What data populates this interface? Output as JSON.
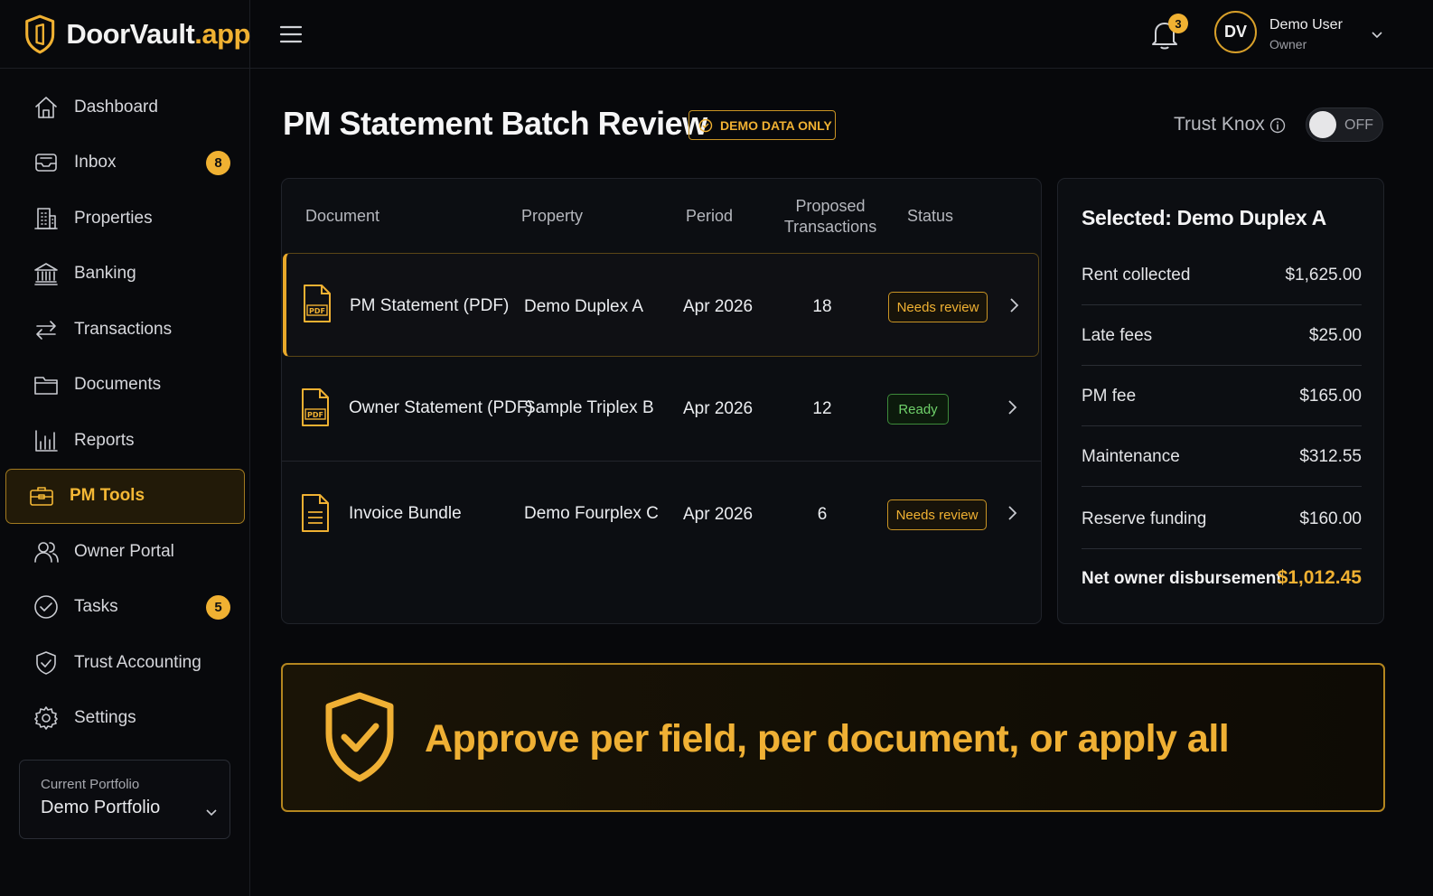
{
  "brand": {
    "name": "DoorVault",
    "tld": ".app"
  },
  "nav": [
    {
      "key": "dashboard",
      "label": "Dashboard",
      "icon": "home-icon"
    },
    {
      "key": "inbox",
      "label": "Inbox",
      "icon": "inbox-icon",
      "badge": "8"
    },
    {
      "key": "properties",
      "label": "Properties",
      "icon": "building-icon"
    },
    {
      "key": "banking",
      "label": "Banking",
      "icon": "bank-icon"
    },
    {
      "key": "transactions",
      "label": "Transactions",
      "icon": "arrows-swap-icon"
    },
    {
      "key": "documents",
      "label": "Documents",
      "icon": "folder-icon"
    },
    {
      "key": "reports",
      "label": "Reports",
      "icon": "bar-chart-icon"
    },
    {
      "key": "pm-tools",
      "label": "PM Tools",
      "icon": "briefcase-icon",
      "active": true
    },
    {
      "key": "owner-portal",
      "label": "Owner Portal",
      "icon": "users-icon"
    },
    {
      "key": "tasks",
      "label": "Tasks",
      "icon": "check-circle-icon",
      "badge": "5"
    },
    {
      "key": "trust-accounting",
      "label": "Trust Accounting",
      "icon": "shield-check-icon"
    },
    {
      "key": "settings",
      "label": "Settings",
      "icon": "gear-icon"
    }
  ],
  "portfolio": {
    "caption": "Current Portfolio",
    "value": "Demo Portfolio"
  },
  "topbar": {
    "notifications": "3",
    "avatar_initials": "DV",
    "user_name": "Demo User",
    "user_role": "Owner"
  },
  "page": {
    "title": "PM Statement Batch Review",
    "demo_badge": "DEMO DATA ONLY",
    "trust_label": "Trust Knox",
    "toggle_state": "OFF"
  },
  "table": {
    "headers": {
      "document": "Document",
      "property": "Property",
      "period": "Period",
      "proposed_1": "Proposed",
      "proposed_2": "Transactions",
      "status": "Status"
    },
    "rows": [
      {
        "document": "PM Statement (PDF)",
        "property": "Demo Duplex A",
        "period": "Apr 2026",
        "count": "18",
        "status": "Needs review",
        "icon": "pdf-file-icon"
      },
      {
        "document": "Owner Statement (PDF)",
        "property": "Sample Triplex B",
        "period": "Apr 2026",
        "count": "12",
        "status": "Ready",
        "icon": "pdf-file-icon"
      },
      {
        "document": "Invoice Bundle",
        "property": "Demo Fourplex C",
        "period": "Apr 2026",
        "count": "6",
        "status": "Needs review",
        "icon": "document-icon"
      }
    ]
  },
  "summary": {
    "title": "Selected: Demo Duplex A",
    "items": [
      {
        "label": "Rent collected",
        "value": "$1,625.00"
      },
      {
        "label": "Late fees",
        "value": "$25.00"
      },
      {
        "label": "PM fee",
        "value": "$165.00"
      },
      {
        "label": "Maintenance",
        "value": "$312.55"
      },
      {
        "label": "Reserve funding",
        "value": "$160.00"
      }
    ],
    "total_label": "Net owner disbursement",
    "total_value": "$1,012.45"
  },
  "banner": {
    "text": "Approve per field, per document, or apply all"
  },
  "colors": {
    "accent": "#f0b132",
    "ready": "#6fd06a",
    "background": "#07080b"
  }
}
